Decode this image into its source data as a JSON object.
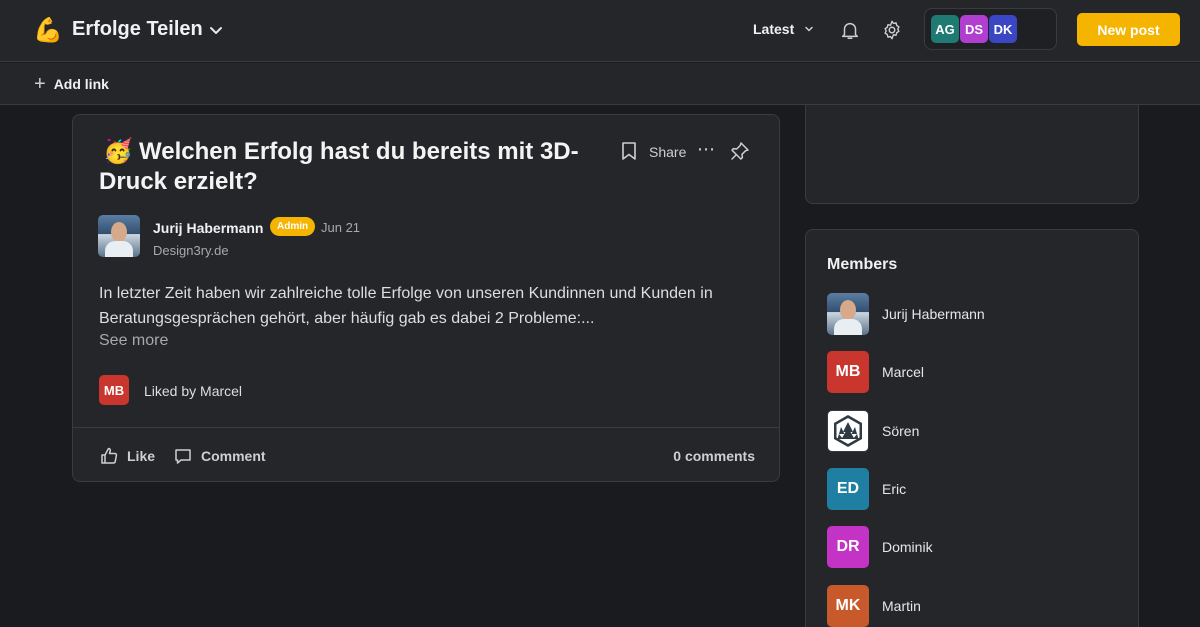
{
  "header": {
    "space_emoji": "💪",
    "space_title": "Erfolge Teilen",
    "sort_label": "Latest",
    "avatars": [
      {
        "initials": "AG",
        "color": "#1f7a73"
      },
      {
        "initials": "DS",
        "color": "#b03fcf"
      },
      {
        "initials": "DK",
        "color": "#3b46c4"
      }
    ],
    "new_post_label": "New post"
  },
  "linkbar": {
    "add_link_label": "Add link"
  },
  "post": {
    "emoji": "🥳",
    "title": "Welchen Erfolg hast du bereits mit 3D-Druck erzielt?",
    "share_label": "Share",
    "author_name": "Jurij Habermann",
    "author_badge": "Admin",
    "date": "Jun 21",
    "author_subtitle": "Design3ry.de",
    "body": "In letzter Zeit haben wir zahlreiche tolle Erfolge von unseren Kundinnen und Kunden in Beratungsgesprächen gehört, aber häufig gab es dabei 2 Probleme:...",
    "see_more": "See more",
    "liker_initials": "MB",
    "liked_by": "Liked by Marcel",
    "like_label": "Like",
    "comment_label": "Comment",
    "comments_count": "0 comments"
  },
  "members": {
    "title": "Members",
    "list": [
      {
        "name": "Jurij Habermann",
        "initials": "",
        "color": "#3c5874"
      },
      {
        "name": "Marcel",
        "initials": "MB",
        "color": "#c8362e"
      },
      {
        "name": "Sören",
        "initials": "",
        "color": "#ffffff"
      },
      {
        "name": "Eric",
        "initials": "ED",
        "color": "#1f7fa3"
      },
      {
        "name": "Dominik",
        "initials": "DR",
        "color": "#c233c6"
      },
      {
        "name": "Martin",
        "initials": "MK",
        "color": "#c8592a"
      }
    ]
  }
}
